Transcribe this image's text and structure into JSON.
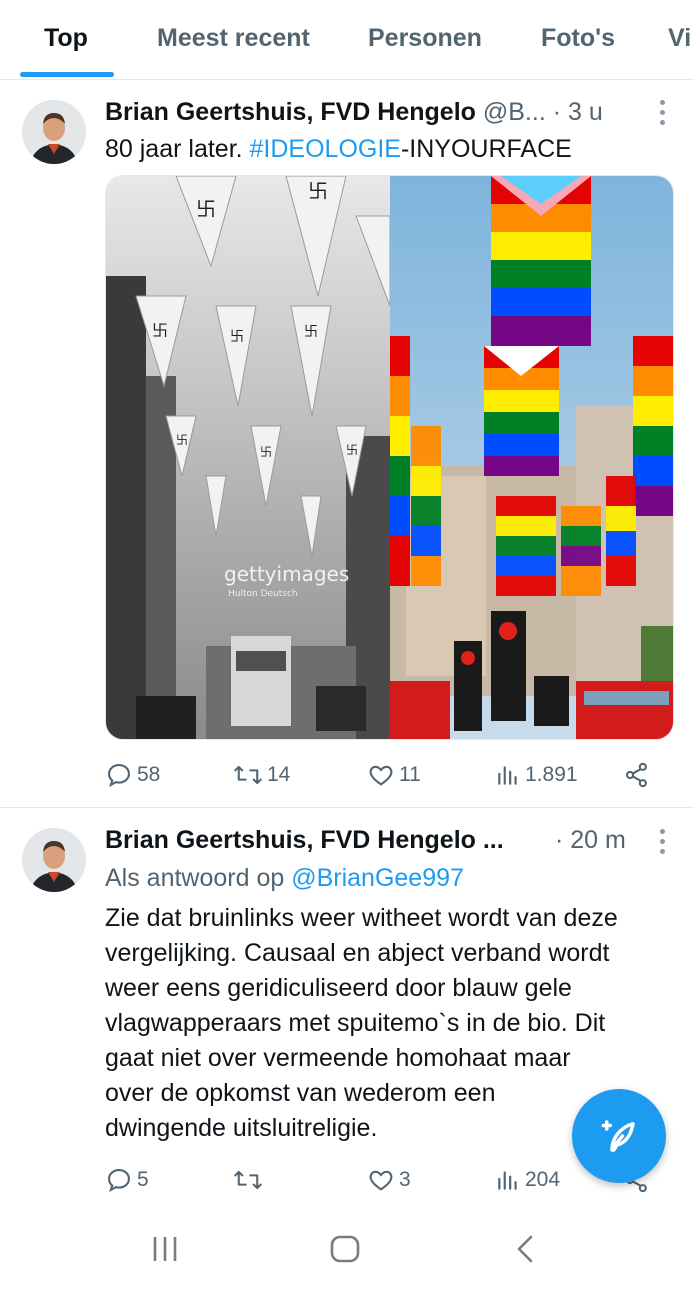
{
  "tabs": [
    {
      "label": "Top",
      "active": true
    },
    {
      "label": "Meest recent",
      "active": false
    },
    {
      "label": "Personen",
      "active": false
    },
    {
      "label": "Foto's",
      "active": false
    },
    {
      "label": "Vi",
      "active": false
    }
  ],
  "tweets": [
    {
      "author": "Brian Geertshuis, FVD Hengelo",
      "handle": "@B...",
      "time": "· 3 u",
      "text_plain": "80 jaar later. ",
      "hashtag": "#IDEOLOGIE",
      "text_suffix": "-INYOURFACE",
      "image_watermark": "gettyimages",
      "image_credit": "Hulton Deutsch",
      "stats": {
        "replies": "58",
        "retweets": "14",
        "likes": "11",
        "views": "1.891"
      }
    },
    {
      "author": "Brian Geertshuis, FVD Hengelo ...",
      "time": "· 20 m",
      "reply_prefix": "Als antwoord op ",
      "reply_to": "@BrianGee997",
      "text_lines": [
        "Zie dat bruinlinks weer witheet wordt van deze",
        "vergelijking. Causaal en abject verband wordt",
        "weer eens geridiculiseerd door blauw gele",
        "vlagwapperaars met spuitemo`s in de bio. Dit",
        "gaat niet over vermeende homohaat maar",
        "over de opkomst van wederom een",
        "dwingende uitsluitreligie."
      ],
      "stats": {
        "replies": "5",
        "retweets": "",
        "likes": "3",
        "views": "204"
      }
    }
  ],
  "colors": {
    "accent": "#1d9bf0",
    "secondary_text": "#536471",
    "primary_text": "#0f1419"
  },
  "icons": [
    "reply-icon",
    "retweet-icon",
    "like-icon",
    "views-icon",
    "share-icon",
    "compose-icon",
    "more-icon"
  ]
}
